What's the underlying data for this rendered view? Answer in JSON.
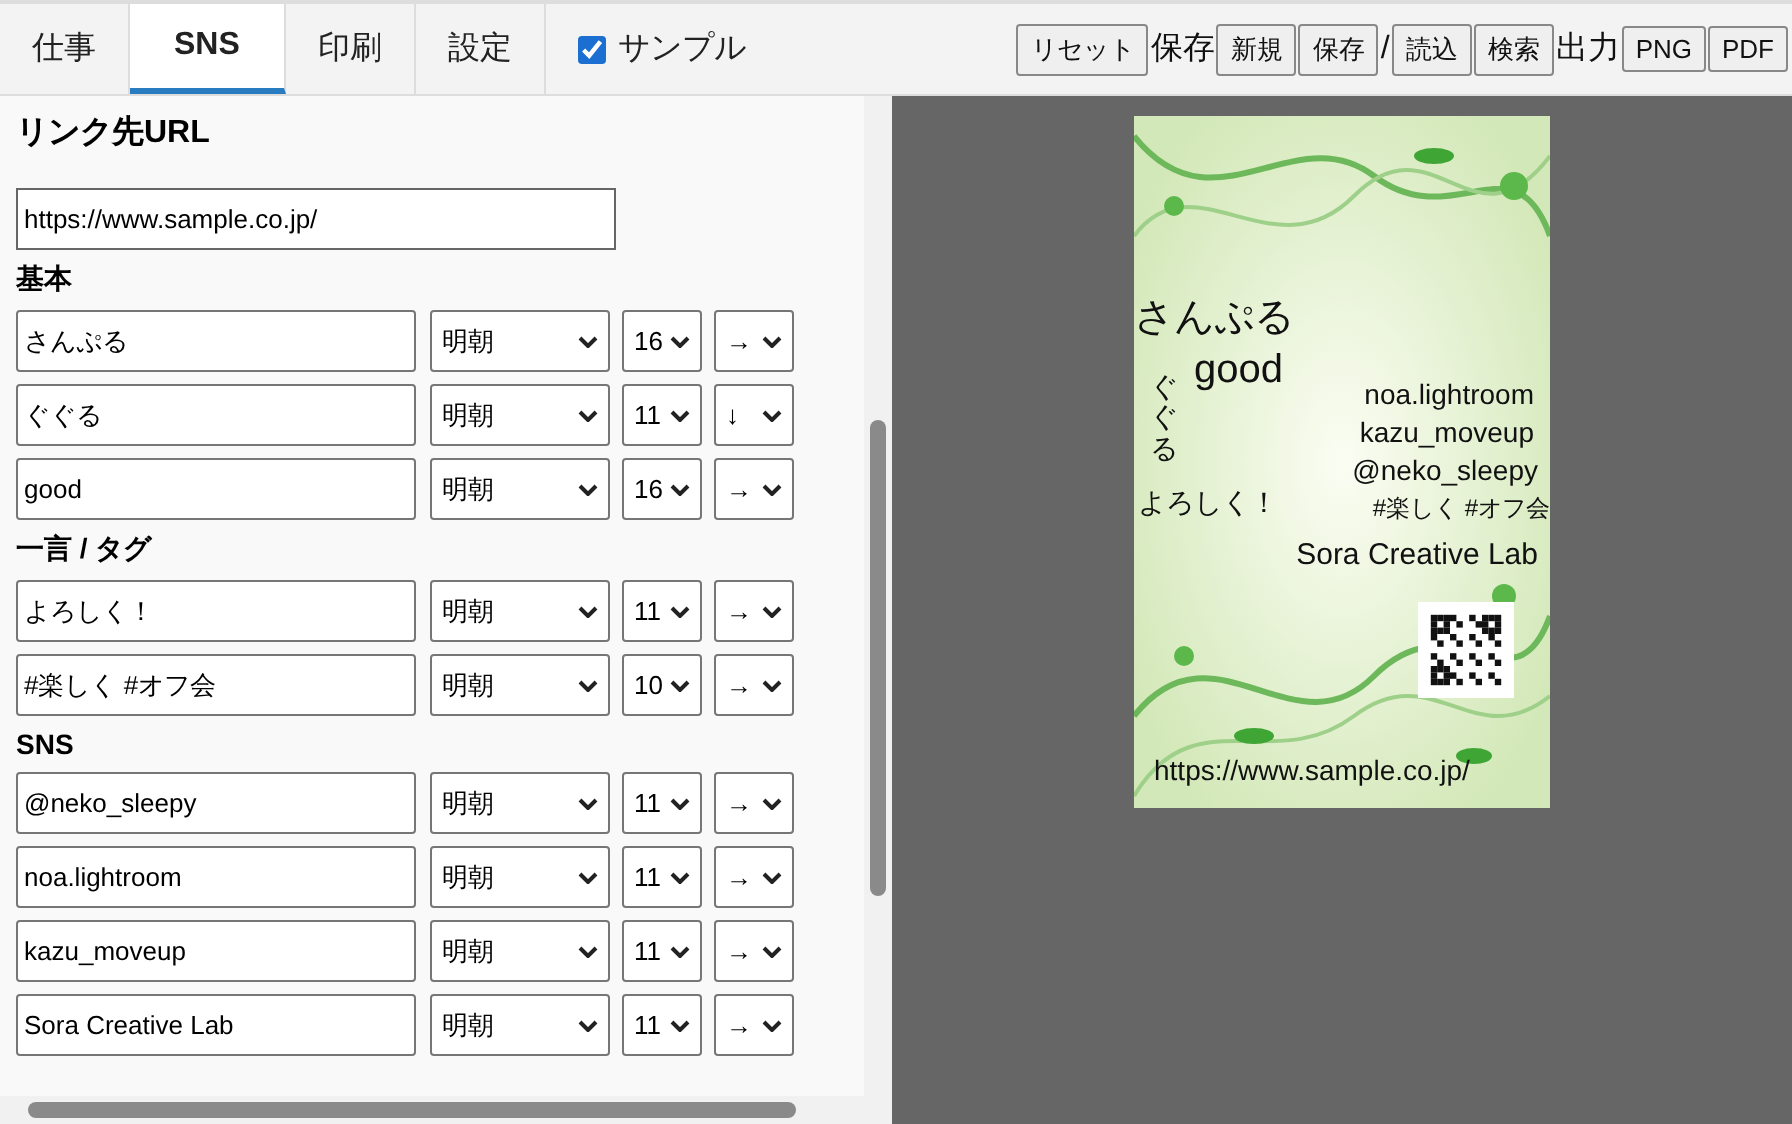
{
  "tabs": [
    {
      "label": "仕事",
      "selected": false
    },
    {
      "label": "SNS",
      "selected": true
    },
    {
      "label": "印刷",
      "selected": false
    },
    {
      "label": "設定",
      "selected": false
    }
  ],
  "sample_toggle": {
    "label": "サンプル",
    "checked": true
  },
  "toolbar": [
    {
      "kind": "button",
      "label": "リセット"
    },
    {
      "kind": "label",
      "label": "保存"
    },
    {
      "kind": "button",
      "label": "新規"
    },
    {
      "kind": "button",
      "label": "保存"
    },
    {
      "kind": "label",
      "label": "/"
    },
    {
      "kind": "button",
      "label": "読込"
    },
    {
      "kind": "button",
      "label": "検索"
    },
    {
      "kind": "label",
      "label": "出力"
    },
    {
      "kind": "button",
      "label": "PNG"
    },
    {
      "kind": "button",
      "label": "PDF"
    }
  ],
  "link_url": {
    "title": "リンク先URL",
    "value": "https://www.sample.co.jp/"
  },
  "sections": [
    {
      "title": "基本",
      "rows": [
        {
          "text": "さんぷる",
          "font": "明朝",
          "size": "16",
          "direction": "→"
        },
        {
          "text": "ぐぐる",
          "font": "明朝",
          "size": "11",
          "direction": "↓"
        },
        {
          "text": "good",
          "font": "明朝",
          "size": "16",
          "direction": "→"
        }
      ]
    },
    {
      "title": "一言 / タグ",
      "rows": [
        {
          "text": "よろしく！",
          "font": "明朝",
          "size": "11",
          "direction": "→"
        },
        {
          "text": "#楽しく #オフ会",
          "font": "明朝",
          "size": "10",
          "direction": "→"
        }
      ]
    },
    {
      "title": "SNS",
      "rows": [
        {
          "text": "@neko_sleepy",
          "font": "明朝",
          "size": "11",
          "direction": "→"
        },
        {
          "text": "noa.lightroom",
          "font": "明朝",
          "size": "11",
          "direction": "→"
        },
        {
          "text": "kazu_moveup",
          "font": "明朝",
          "size": "11",
          "direction": "→"
        },
        {
          "text": "Sora Creative Lab",
          "font": "明朝",
          "size": "11",
          "direction": "→"
        }
      ]
    }
  ],
  "card": {
    "texts": [
      {
        "text": "さんぷる",
        "kind": "horizontal"
      },
      {
        "text": "good",
        "kind": "horizontal"
      },
      {
        "text": "ぐぐる",
        "kind": "vertical"
      },
      {
        "text": "よろしく！",
        "kind": "horizontal"
      },
      {
        "text": "noa.lightroom",
        "kind": "horizontal"
      },
      {
        "text": "kazu_moveup",
        "kind": "horizontal"
      },
      {
        "text": "@neko_sleepy",
        "kind": "horizontal"
      },
      {
        "text": "#楽しく #オフ会",
        "kind": "horizontal"
      },
      {
        "text": "Sora Creative Lab",
        "kind": "horizontal"
      },
      {
        "text": "https://www.sample.co.jp/",
        "kind": "horizontal"
      }
    ]
  }
}
